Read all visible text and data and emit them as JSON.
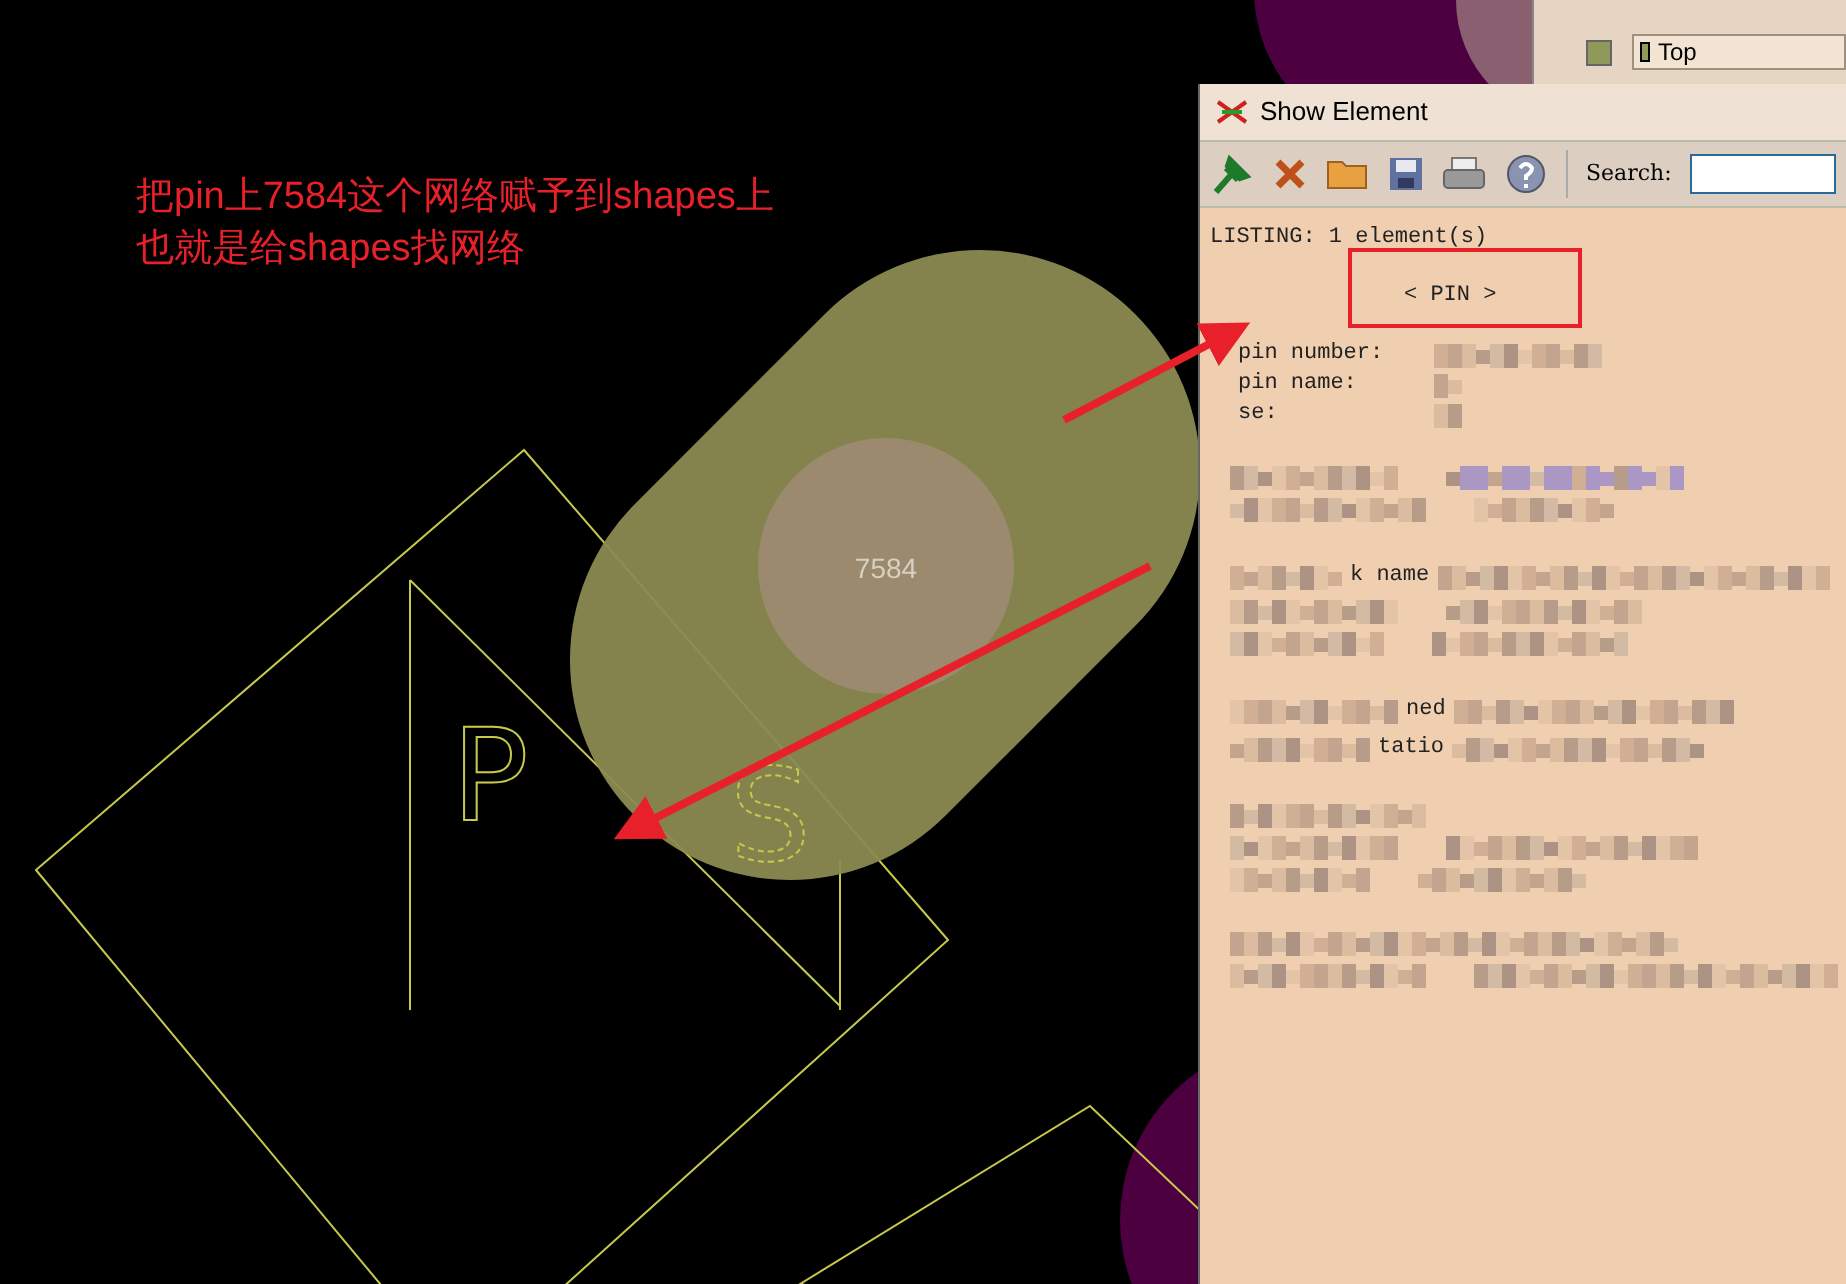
{
  "annotation": {
    "lines": [
      "把pin上7584这个网络赋予到shapes上",
      "也就是给shapes找网络"
    ]
  },
  "canvas": {
    "net_label": "7584",
    "silkscreen": [
      "P",
      "S"
    ]
  },
  "layer_panel": {
    "layer": "Top"
  },
  "show_element": {
    "title": "Show Element",
    "search_label": "Search:",
    "listing_header": "LISTING: 1 element(s)",
    "element_type": "< PIN >",
    "fields": [
      "pin number:",
      "pin name:",
      "se:"
    ],
    "partial_texts": [
      "k name",
      "ned",
      "tatio"
    ]
  }
}
